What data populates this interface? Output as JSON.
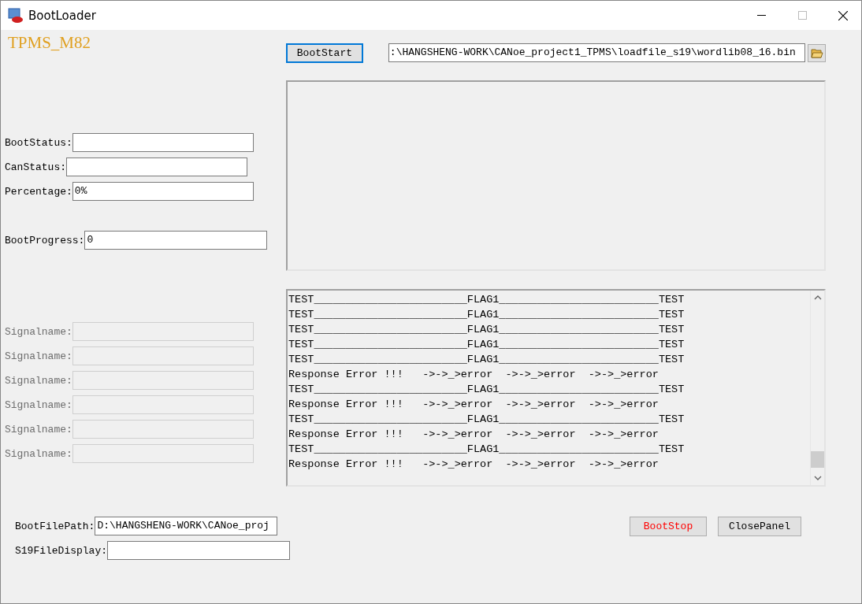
{
  "window": {
    "title": "BootLoader"
  },
  "app_title": "TPMS_M82",
  "status_fields": [
    {
      "label": "BootStatus:"
    },
    {
      "label": "CanStatus:"
    },
    {
      "label": "Percentage:",
      "value": "0%"
    }
  ],
  "progress_field": {
    "label": "BootProgress:",
    "value": "0"
  },
  "signal_fields": [
    {
      "label": "Signalname:",
      "disabled": true
    },
    {
      "label": "Signalname:",
      "disabled": true
    },
    {
      "label": "Signalname:",
      "disabled": true
    },
    {
      "label": "Signalname:",
      "disabled": true
    },
    {
      "label": "Signalname:",
      "disabled": true
    },
    {
      "label": "Signalname:",
      "disabled": true
    }
  ],
  "boot_start_button": {
    "label": "BootStart",
    "focused": true
  },
  "file_path": {
    "value": ":\\HANGSHENG-WORK\\CANoe_project1_TPMS\\loadfile_s19\\wordlib08_16.bin"
  },
  "log_lines": [
    "TEST________________________FLAG1_________________________TEST",
    "TEST________________________FLAG1_________________________TEST",
    "TEST________________________FLAG1_________________________TEST",
    "TEST________________________FLAG1_________________________TEST",
    "TEST________________________FLAG1_________________________TEST",
    "Response Error !!!   ->->_>error  ->->_>error  ->->_>error",
    "TEST________________________FLAG1_________________________TEST",
    "Response Error !!!   ->->_>error  ->->_>error  ->->_>error",
    "TEST________________________FLAG1_________________________TEST",
    "Response Error !!!   ->->_>error  ->->_>error  ->->_>error",
    "TEST________________________FLAG1_________________________TEST",
    "Response Error !!!   ->->_>error  ->->_>error  ->->_>error"
  ],
  "boot_file_path": {
    "label": "BootFilePath:",
    "value": "D:\\HANGSHENG-WORK\\CANoe_proj"
  },
  "s19_display": {
    "label": "S19FileDisplay:"
  },
  "buttons": [
    {
      "label": "BootStop",
      "kind": "danger"
    },
    {
      "label": "ClosePanel",
      "kind": "normal"
    }
  ]
}
